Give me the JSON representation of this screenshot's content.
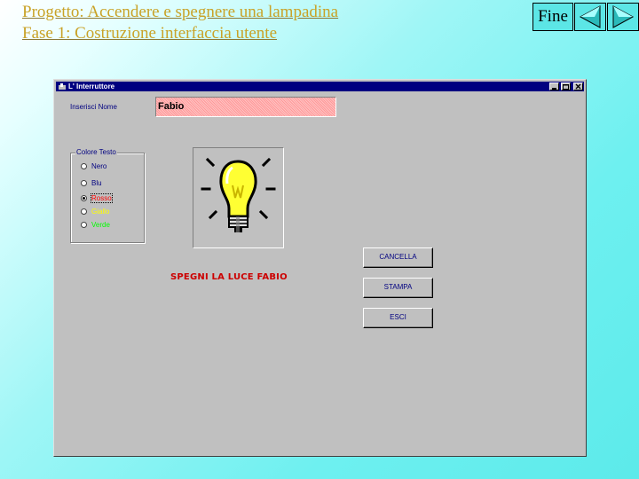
{
  "slide": {
    "title_line1": "Progetto: Accendere e spegnere una lampadina",
    "title_line2": "Fase 1: Costruzione interfaccia utente"
  },
  "nav": {
    "fine_label": "Fine",
    "prev_icon": "triangle-left-icon",
    "next_icon": "triangle-right-icon"
  },
  "window": {
    "title": "L' Interruttore",
    "icon": "switch-app-icon",
    "controls": [
      "minimize-icon",
      "maximize-icon",
      "close-icon"
    ],
    "name_label": "Inserisci Nome",
    "name_value": "Fabio",
    "color_group_title": "Colore Testo",
    "color_options": [
      {
        "label": "Nero",
        "color": "#000080",
        "selected": false
      },
      {
        "label": "Blu",
        "color": "#000080",
        "selected": false
      },
      {
        "label": "Rosso",
        "color": "#ff0000",
        "selected": true
      },
      {
        "label": "Giallo",
        "color": "#ffff00",
        "selected": false
      },
      {
        "label": "Verde",
        "color": "#00ff00",
        "selected": false
      }
    ],
    "bulb_icon": "lightbulb-icon",
    "message": "SPEGNI LA LUCE FABIO",
    "message_color": "#cc0000",
    "buttons": {
      "cancel": "CANCELLA",
      "print": "STAMPA",
      "exit": "ESCI"
    }
  }
}
